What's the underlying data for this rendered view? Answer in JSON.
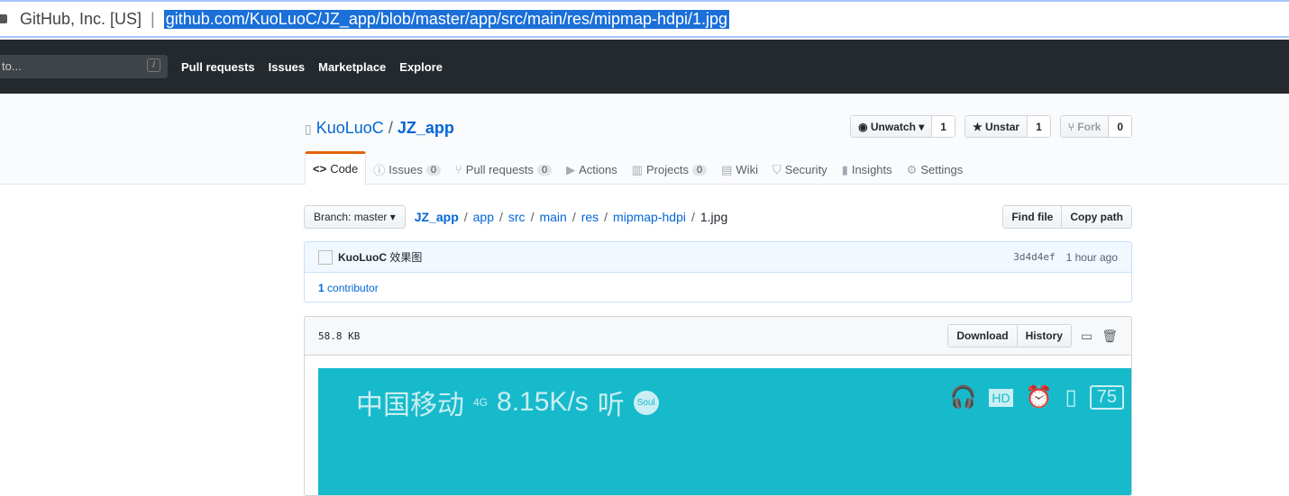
{
  "browser": {
    "site": "GitHub, Inc. [US]",
    "url": "github.com/KuoLuoC/JZ_app/blob/master/app/src/main/res/mipmap-hdpi/1.jpg"
  },
  "nav": {
    "search_placeholder": "to...",
    "slash": "/",
    "links": [
      "Pull requests",
      "Issues",
      "Marketplace",
      "Explore"
    ]
  },
  "repo": {
    "owner": "KuoLuoC",
    "sep": "/",
    "name": "JZ_app",
    "watch": {
      "label": "Unwatch",
      "count": "1"
    },
    "star": {
      "label": "Unstar",
      "count": "1"
    },
    "fork": {
      "label": "Fork",
      "count": "0"
    },
    "tabs": [
      {
        "label": "Code",
        "icon": "<>"
      },
      {
        "label": "Issues",
        "count": "0",
        "icon": "ⓘ"
      },
      {
        "label": "Pull requests",
        "count": "0",
        "icon": "⑂"
      },
      {
        "label": "Actions",
        "icon": "▶"
      },
      {
        "label": "Projects",
        "count": "0",
        "icon": "▥"
      },
      {
        "label": "Wiki",
        "icon": "▤"
      },
      {
        "label": "Security",
        "icon": "⛉"
      },
      {
        "label": "Insights",
        "icon": "▮"
      },
      {
        "label": "Settings",
        "icon": "⚙"
      }
    ]
  },
  "breadcrumb": {
    "branch": "Branch: master",
    "parts": [
      "JZ_app",
      "app",
      "src",
      "main",
      "res",
      "mipmap-hdpi"
    ],
    "file": "1.jpg"
  },
  "file_buttons": {
    "find": "Find file",
    "copy": "Copy path"
  },
  "commit": {
    "author": "KuoLuoC",
    "message": "效果图",
    "sha": "3d4d4ef",
    "time": "1 hour ago",
    "contributors_count": "1",
    "contributors_label": "contributor"
  },
  "file": {
    "size": "58.8 KB",
    "download": "Download",
    "history": "History"
  },
  "preview": {
    "carrier": "中国移动",
    "network": "4G",
    "speed": "8.15K/s",
    "app": "听",
    "soul": "Soul",
    "hd": "HD",
    "battery": "75",
    "color": "#17bacb"
  }
}
